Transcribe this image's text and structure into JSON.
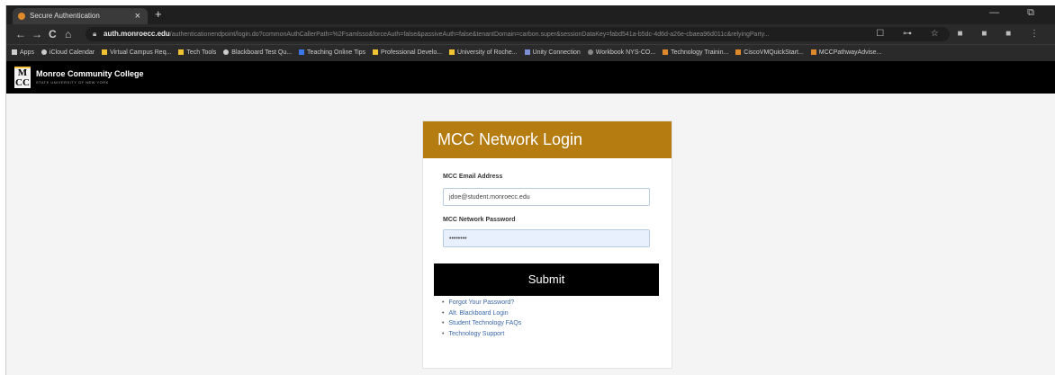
{
  "browser": {
    "tab_title": "Secure Authentication",
    "tab_close": "×",
    "new_tab": "+",
    "window_controls": "— ⧉",
    "url_domain": "auth.monroecc.edu",
    "url_path": "/authenticationendpoint/login.do?commonAuthCallerPath=%2Fsamlsso&forceAuth=false&passiveAuth=false&tenantDomain=carbon.super&sessionDataKey=fabd541a-b5dc-4d6d-a26e-cbaea96d011c&relyingParty...",
    "nav": {
      "back": "←",
      "forward": "→",
      "reload": "C",
      "home": "⌂"
    },
    "toolbar_icons": "☐ ⊶ ☆ ■ ■ ■ ⋮",
    "bookmarks": [
      "Apps",
      "iCloud Calendar",
      "Virtual Campus Req...",
      "Tech Tools",
      "Blackboard Test Qu...",
      "Teaching Online Tips",
      "Professional Develo...",
      "University of Roche...",
      "Unity Connection",
      "Workbook NYS-CO...",
      "Technology Trainin...",
      "CiscoVMQuickStart...",
      "MCCPathwayAdvise..."
    ]
  },
  "site": {
    "logo_text": "M CC",
    "title": "Monroe Community College",
    "subtitle": "STATE UNIVERSITY OF NEW YORK"
  },
  "login": {
    "heading": "MCC Network Login",
    "email_label": "MCC Email Address",
    "email_value": "jdoe@student.monroecc.edu",
    "password_label": "MCC Network Password",
    "password_value": "••••••••",
    "submit_label": "Submit",
    "links": [
      "Forgot Your Password?",
      "Alt. Blackboard Login",
      "Student Technology FAQs",
      "Technology Support"
    ]
  },
  "colors": {
    "accent": "#b47c11",
    "header_bg": "#000000",
    "link": "#3a68a8"
  }
}
